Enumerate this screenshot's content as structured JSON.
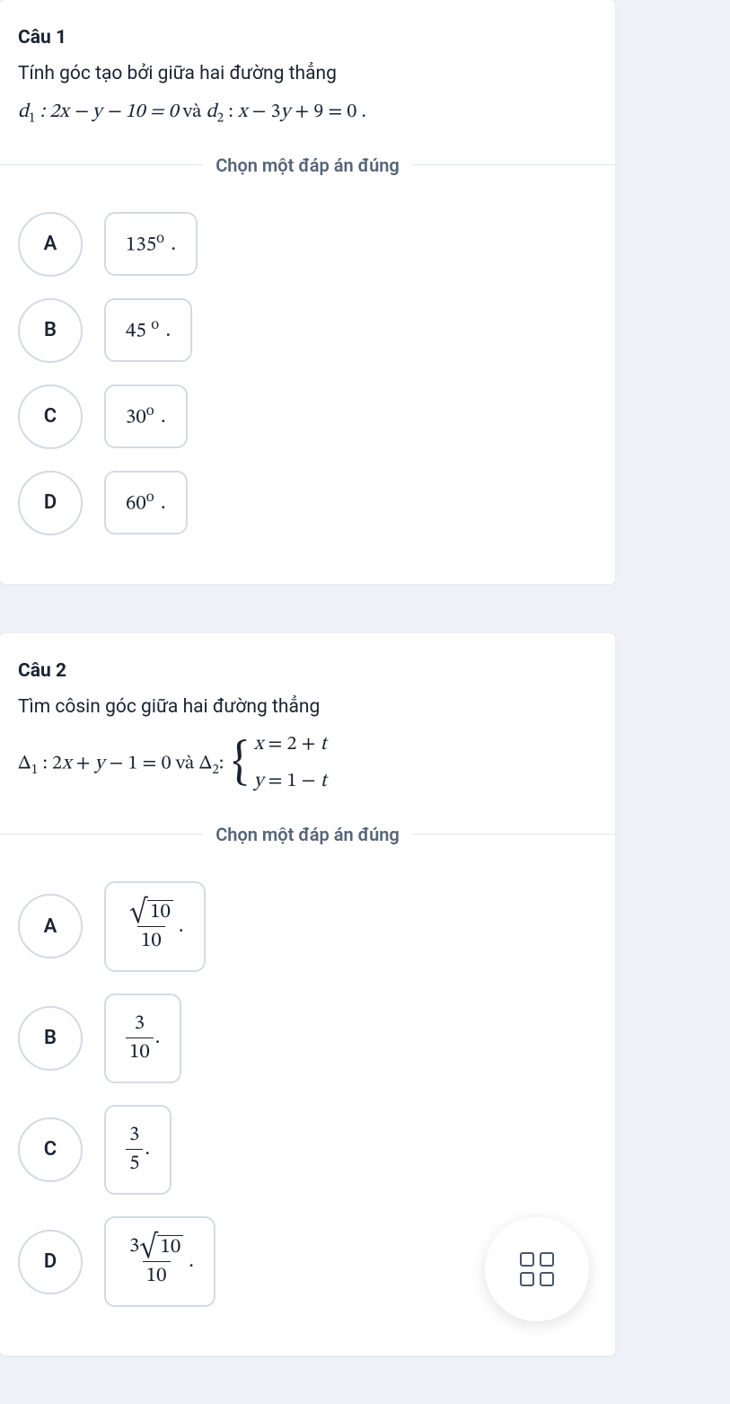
{
  "question1": {
    "title": "Câu 1",
    "prompt": "Tính góc tạo bởi giữa hai đường thẳng",
    "eq_d1_label": "d",
    "eq_d1_sub": "1",
    "eq_d1_body": ": 2x − y − 10 = 0",
    "eq_conj": " và ",
    "eq_d2_label": "d",
    "eq_d2_sub": "2",
    "eq_d2_body": ": x − 3y + 9 = 0 .",
    "divider": "Chọn một đáp án đúng",
    "options": [
      {
        "letter": "A",
        "value": "135",
        "degree": "o",
        "suffix": " ."
      },
      {
        "letter": "B",
        "value": "45 ",
        "degree": "o",
        "suffix": " ."
      },
      {
        "letter": "C",
        "value": "30",
        "degree": "o",
        "suffix": " ."
      },
      {
        "letter": "D",
        "value": "60",
        "degree": "o",
        "suffix": " ."
      }
    ]
  },
  "question2": {
    "title": "Câu 2",
    "prompt": "Tìm côsin góc giữa hai đường thẳng",
    "eq_delta1_label": "Δ",
    "eq_delta1_sub": "1",
    "eq_delta1_body": ": 2x + y − 1 = 0",
    "eq_conj": " và ",
    "eq_delta2_label": "Δ",
    "eq_delta2_sub": "2",
    "eq_delta2_colon": ": ",
    "brace_line1": "x = 2 + t",
    "brace_line2": "y = 1 − t",
    "divider": "Chọn một đáp án đúng",
    "options": [
      {
        "letter": "A",
        "type": "sqrtfrac",
        "sqrt_in": "10",
        "den": "10",
        "suffix": "."
      },
      {
        "letter": "B",
        "type": "frac",
        "num": "3",
        "den": "10",
        "suffix": "."
      },
      {
        "letter": "C",
        "type": "frac",
        "num": "3",
        "den": "5",
        "suffix": "."
      },
      {
        "letter": "D",
        "type": "coefsqrtfrac",
        "coef": "3",
        "sqrt_in": "10",
        "den": "10",
        "suffix": "."
      }
    ]
  },
  "fab_name": "grid-menu"
}
